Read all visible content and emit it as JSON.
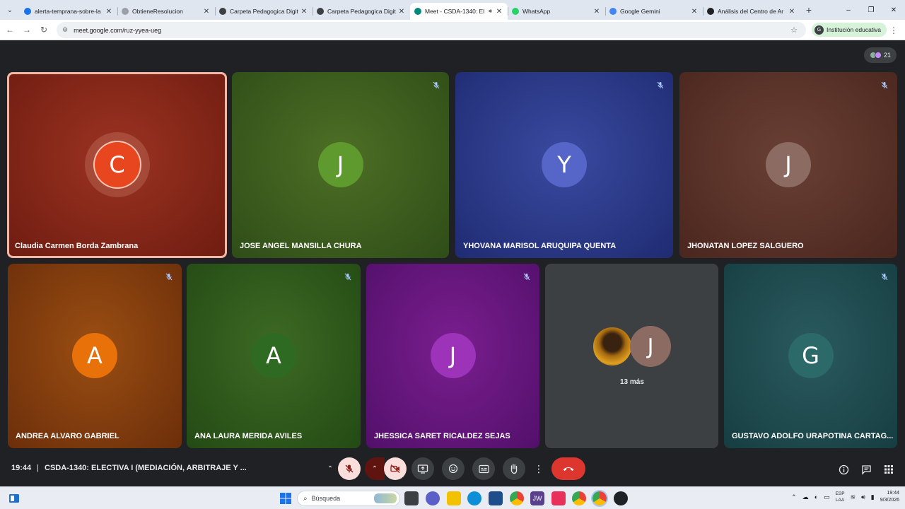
{
  "browser": {
    "tabs": [
      {
        "title": "alerta-temprana-sobre-la",
        "favicon_color": "#1a73e8",
        "active": false
      },
      {
        "title": "ObtieneResolucion",
        "favicon_color": "#9aa0a6",
        "active": false
      },
      {
        "title": "Carpeta Pedagogica Digit",
        "favicon_color": "#3c4043",
        "active": false
      },
      {
        "title": "Carpeta Pedagogica Digit",
        "favicon_color": "#3c4043",
        "active": false
      },
      {
        "title": "Meet - CSDA-1340: El",
        "favicon_color": "#00897b",
        "active": true
      },
      {
        "title": "WhatsApp",
        "favicon_color": "#25d366",
        "active": false
      },
      {
        "title": "Google Gemini",
        "favicon_color": "#4285f4",
        "active": false
      },
      {
        "title": "Análisis del Centro de Ar",
        "favicon_color": "#202124",
        "active": false
      }
    ],
    "new_tab_icon": "+",
    "window_controls": {
      "minimize": "–",
      "restore": "❐",
      "close": "✕"
    },
    "url": "meet.google.com/ruz-yyea-ueg",
    "profile": {
      "initial": "G",
      "label": "Institución educativa"
    }
  },
  "meet": {
    "participants_count": "21",
    "row1": [
      {
        "name": "Claudia Carmen Borda Zambrana",
        "initial": "C",
        "avatar_color": "#e8461f",
        "bg_from": "#9c3322",
        "bg_to": "#6e1c10",
        "speaking": true,
        "muted": false
      },
      {
        "name": "JOSE ANGEL MANSILLA CHURA",
        "initial": "J",
        "avatar_color": "#5e9a2e",
        "bg_from": "#4d6f25",
        "bg_to": "#2f4d18",
        "speaking": false,
        "muted": true
      },
      {
        "name": "YHOVANA MARISOL ARUQUIPA QUENTA",
        "initial": "Y",
        "avatar_color": "#5565c8",
        "bg_from": "#3a4aa0",
        "bg_to": "#1f2b72",
        "speaking": false,
        "muted": true
      },
      {
        "name": "JHONATAN LOPEZ SALGUERO",
        "initial": "J",
        "avatar_color": "#8c6b62",
        "bg_from": "#6a4034",
        "bg_to": "#4a261e",
        "speaking": false,
        "muted": true
      }
    ],
    "row2": [
      {
        "name": "ANDREA ALVARO GABRIEL",
        "initial": "A",
        "avatar_color": "#e8710a",
        "bg_from": "#9a4e12",
        "bg_to": "#6c2e0a",
        "muted": true
      },
      {
        "name": "ANA LAURA MERIDA AVILES",
        "initial": "A",
        "avatar_color": "#2f6a22",
        "bg_from": "#3d6a24",
        "bg_to": "#234a14",
        "muted": true
      },
      {
        "name": "JHESSICA SARET RICALDEZ SEJAS",
        "initial": "J",
        "avatar_color": "#9c33b8",
        "bg_from": "#7a1e8f",
        "bg_to": "#52106a",
        "muted": true
      },
      {
        "name": "GUSTAVO ADOLFO URAPOTINA CARTAG...",
        "initial": "G",
        "avatar_color": "#2c6a6a",
        "bg_from": "#2a5a5e",
        "bg_to": "#163e42",
        "muted": true
      }
    ],
    "more_tile": {
      "initial": "J",
      "label": "13 más"
    },
    "time": "19:44",
    "meeting_title": "CSDA-1340: ELECTIVA I (MEDIACIÓN, ARBITRAJE Y ..."
  },
  "taskbar": {
    "search_placeholder": "Búsqueda",
    "lang_top": "ESP",
    "lang_bottom": "LAA",
    "clock_time": "19:44",
    "clock_date": "9/3/2026"
  }
}
